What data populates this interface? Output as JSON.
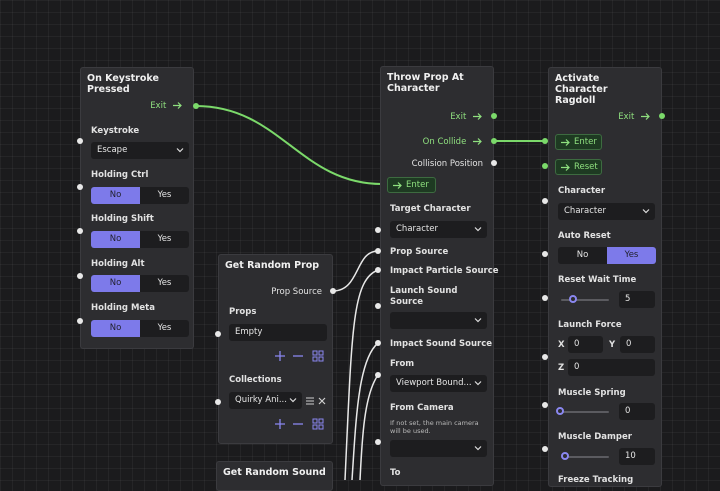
{
  "colors": {
    "flow": "#7bd96a",
    "accent": "#7d7aea",
    "panel": "#2d2d30",
    "field": "#1d1d1f"
  },
  "node_keystroke": {
    "title": "On Keystroke Pressed",
    "exit": "Exit",
    "keystroke_label": "Keystroke",
    "keystroke_value": "Escape",
    "holding_ctrl": "Holding Ctrl",
    "holding_shift": "Holding Shift",
    "holding_alt": "Holding Alt",
    "holding_meta": "Holding Meta",
    "no": "No",
    "yes": "Yes"
  },
  "node_random_prop": {
    "title": "Get Random Prop",
    "prop_source": "Prop Source",
    "props_label": "Props",
    "props_value": "Empty",
    "collections_label": "Collections",
    "collections_value": "Quirky Ani..."
  },
  "node_random_sound": {
    "title": "Get Random Sound"
  },
  "node_throw": {
    "title": "Throw Prop At Character",
    "exit": "Exit",
    "on_collide": "On Collide",
    "collision_position": "Collision Position",
    "enter": "Enter",
    "target_character": "Target Character",
    "target_character_value": "Character",
    "prop_source": "Prop Source",
    "impact_particle_source": "Impact Particle Source",
    "launch_sound_source": "Launch Sound Source",
    "impact_sound_source": "Impact Sound Source",
    "from_label": "From",
    "from_value": "Viewport Bound...",
    "from_camera": "From Camera",
    "from_camera_hint": "If not set, the main camera will be used.",
    "to_label": "To"
  },
  "node_ragdoll": {
    "title": "Activate Character Ragdoll",
    "exit": "Exit",
    "enter": "Enter",
    "reset": "Reset",
    "character_label": "Character",
    "character_value": "Character",
    "auto_reset": "Auto Reset",
    "no": "No",
    "yes": "Yes",
    "reset_wait_time": "Reset Wait Time",
    "reset_wait_value": "5",
    "launch_force": "Launch Force",
    "x_label": "X",
    "x_value": "0",
    "y_label": "Y",
    "y_value": "0",
    "z_label": "Z",
    "z_value": "0",
    "muscle_spring": "Muscle Spring",
    "muscle_spring_value": "0",
    "muscle_damper": "Muscle Damper",
    "muscle_damper_value": "10",
    "freeze_tracking": "Freeze Tracking"
  }
}
